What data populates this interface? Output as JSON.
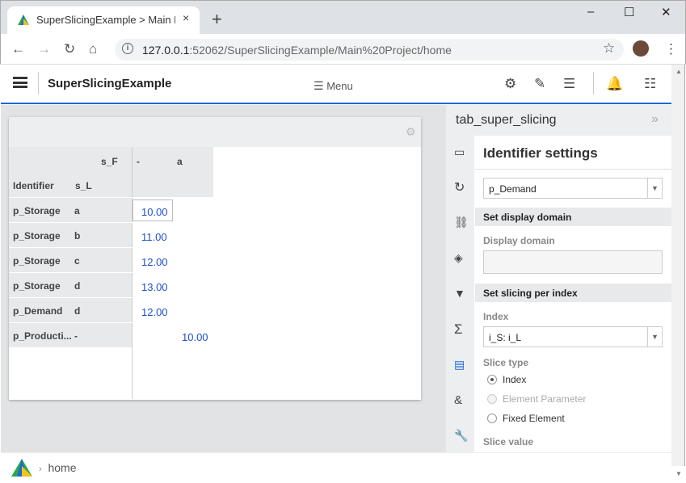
{
  "browser": {
    "tab_title": "SuperSlicingExample > Main Proj",
    "tab_close": "×",
    "new_tab": "+",
    "window_controls": [
      "–",
      "☐",
      "✕"
    ],
    "url_host": "127.0.0.1",
    "url_path": ":52062/SuperSlicingExample/Main%20Project/home",
    "nav_icons": [
      "back-icon",
      "forward-icon",
      "reload-icon",
      "home-icon",
      "info-icon",
      "star-icon",
      "avatar",
      "kebab-menu-icon"
    ]
  },
  "app": {
    "name": "SuperSlicingExample",
    "menu_label": "Menu",
    "header_icons": [
      "gear-icon",
      "pencil-icon",
      "list-icon",
      "bell-icon",
      "sliders-icon"
    ]
  },
  "table": {
    "col_header_top": "s_F",
    "col_header_top_values": [
      "-",
      "a"
    ],
    "row_headers": [
      "Identifier",
      "s_L"
    ],
    "rows": [
      {
        "identifier": "p_Storage",
        "s_L": "a",
        "value": "10.00"
      },
      {
        "identifier": "p_Storage",
        "s_L": "b",
        "value": "11.00"
      },
      {
        "identifier": "p_Storage",
        "s_L": "c",
        "value": "12.00"
      },
      {
        "identifier": "p_Storage",
        "s_L": "d",
        "value": "13.00"
      },
      {
        "identifier": "p_Demand",
        "s_L": "d",
        "value": "12.00"
      },
      {
        "identifier": "p_Producti...",
        "s_L": "-",
        "value": "10.00"
      }
    ]
  },
  "side_panel": {
    "title": "tab_super_slicing",
    "collapse_glyph": "»",
    "heading": "Identifier settings",
    "identifier_select": "p_Demand",
    "section_display_domain": "Set display domain",
    "display_domain_label": "Display domain",
    "display_domain_value": "",
    "section_slicing": "Set slicing per index",
    "index_label": "Index",
    "index_select": "i_S: i_L",
    "slice_type_label": "Slice type",
    "slice_types": [
      "Index",
      "Element Parameter",
      "Fixed Element"
    ],
    "slice_type_selected": "Index",
    "slice_value_label": "Slice value",
    "icons": [
      "inbox-icon",
      "refresh-icon",
      "link-icon",
      "layers-icon",
      "filter-icon",
      "sigma-icon",
      "document-icon",
      "ampersand-icon",
      "wrench-icon"
    ]
  },
  "footer": {
    "breadcrumb": "home"
  }
}
